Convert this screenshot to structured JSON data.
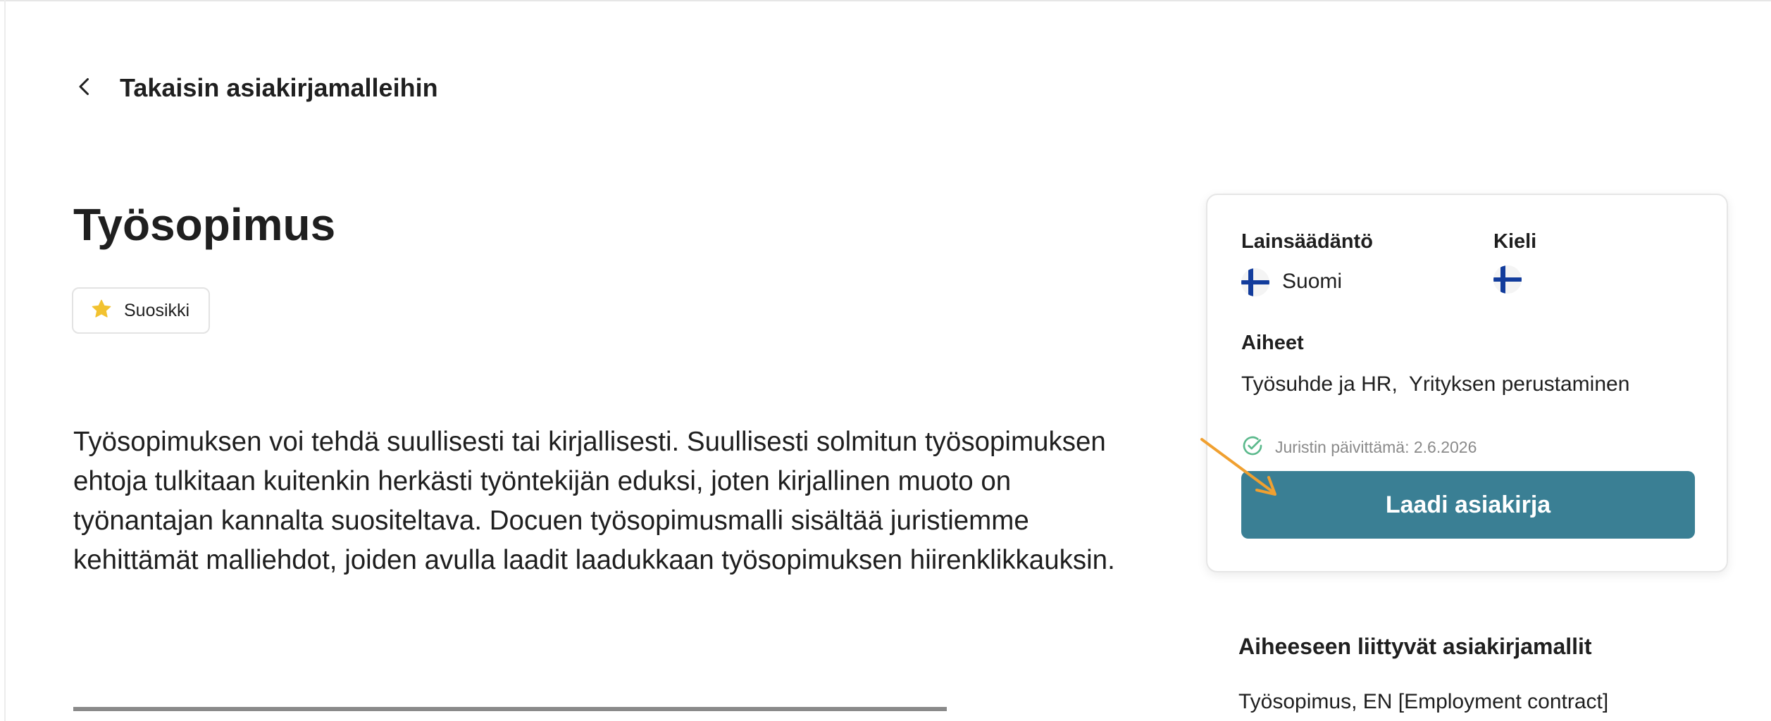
{
  "back_link": {
    "label": "Takaisin asiakirjamalleihin",
    "icon": "chevron-left-icon"
  },
  "page": {
    "title": "Työsopimus",
    "favorite_label": "Suosikki",
    "description": "Työsopimuksen voi tehdä suullisesti tai kirjallisesti. Suullisesti solmitun työsopimuksen ehtoja tulkitaan kuitenkin herkästi työntekijän eduksi, joten kirjallinen muoto on työnantajan kannalta suositeltava. Docuen työsopimusmalli sisältää juristiemme kehittämät malliehdot, joiden avulla laadit laadukkaan työsopimuksen hiirenklikkauksin."
  },
  "sidebar_card": {
    "legislation_label": "Lainsäädäntö",
    "legislation_value": "Suomi",
    "language_label": "Kieli",
    "topics_label": "Aiheet",
    "topics_value": "Työsuhde ja HR,  Yrityksen perustaminen",
    "updated_text": "Juristin päivittämä: 2.6.2026",
    "cta_label": "Laadi asiakirja"
  },
  "related": {
    "title": "Aiheeseen liittyvät asiakirjamallit",
    "items": [
      "Työsopimus, EN [Employment contract]"
    ]
  },
  "colors": {
    "accent": "#3a7f94",
    "star": "#f2c230",
    "check": "#5bb98c",
    "annotation_arrow": "#f0a030",
    "flag_blue": "#123c9c"
  }
}
